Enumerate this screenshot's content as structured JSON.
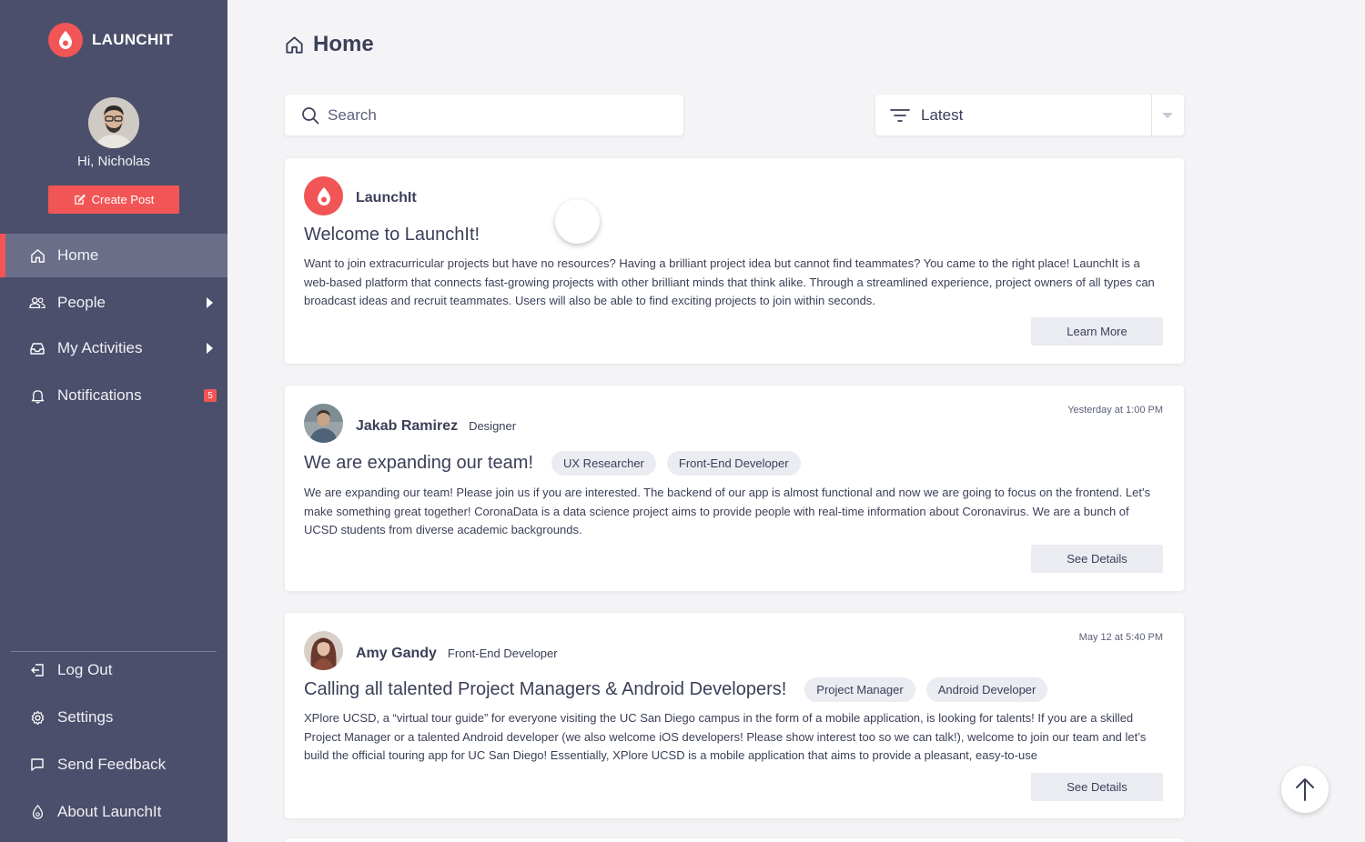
{
  "brand": {
    "name": "LAUNCHIT"
  },
  "user": {
    "greeting": "Hi, Nicholas"
  },
  "sidebar": {
    "create_post": "Create Post",
    "items": [
      {
        "label": "Home",
        "icon": "home-icon",
        "active": true
      },
      {
        "label": "People",
        "icon": "people-icon"
      },
      {
        "label": "My Activities",
        "icon": "inbox-icon"
      },
      {
        "label": "Notifications",
        "icon": "bell-icon",
        "badge": "5"
      }
    ],
    "bottom": [
      {
        "label": "Log Out",
        "icon": "logout-icon"
      },
      {
        "label": "Settings",
        "icon": "gear-icon"
      },
      {
        "label": "Send Feedback",
        "icon": "feedback-icon"
      },
      {
        "label": "About LaunchIt",
        "icon": "flame-icon"
      }
    ]
  },
  "header": {
    "title": "Home"
  },
  "search": {
    "placeholder": "Search"
  },
  "sort": {
    "selected": "Latest"
  },
  "posts": [
    {
      "author": "LaunchIt",
      "title": "Welcome to LaunchIt!",
      "body": "Want to join extracurricular projects but have no resources? Having a brilliant project idea but cannot find teammates? You came to the right place! LaunchIt is a web-based platform that connects fast-growing projects with other brilliant minds that think alike. Through a streamlined experience, project owners of all types can broadcast ideas and recruit teammates. Users will also be able to find exciting projects to join within seconds.",
      "button": "Learn More"
    },
    {
      "author": "Jakab Ramirez",
      "role": "Designer",
      "time": "Yesterday at 1:00 PM",
      "title": "We are expanding our team!",
      "tags": [
        "UX Researcher",
        "Front-End Developer"
      ],
      "body": "We are expanding our team! Please join us if you are interested. The backend of our app is almost functional and now we are going to focus on the frontend. Let’s make something great together! CoronaData is a data science project aims to provide people with real-time information about Coronavirus. We are a bunch of UCSD students from diverse academic backgrounds.",
      "button": "See Details"
    },
    {
      "author": "Amy Gandy",
      "role": "Front-End Developer",
      "time": "May 12 at 5:40 PM",
      "title": "Calling all talented Project Managers & Android Developers!",
      "tags": [
        "Project Manager",
        "Android Developer"
      ],
      "body": "XPlore UCSD, a “virtual tour guide” for everyone visiting the UC San Diego campus in the form of a mobile application, is looking for talents! If you are a skilled Project Manager or a talented Android developer (we also welcome iOS developers! Please show interest too so we can talk!), welcome to join our team and let’s build the official touring app for UC San Diego! Essentially, XPlore UCSD is a mobile application that aims to provide a pleasant, easy-to-use",
      "button": "See Details"
    }
  ],
  "colors": {
    "sidebar": "#4c4f6b",
    "accent": "#f25555",
    "active": "#6b6e89",
    "background": "#f4f4f7"
  }
}
